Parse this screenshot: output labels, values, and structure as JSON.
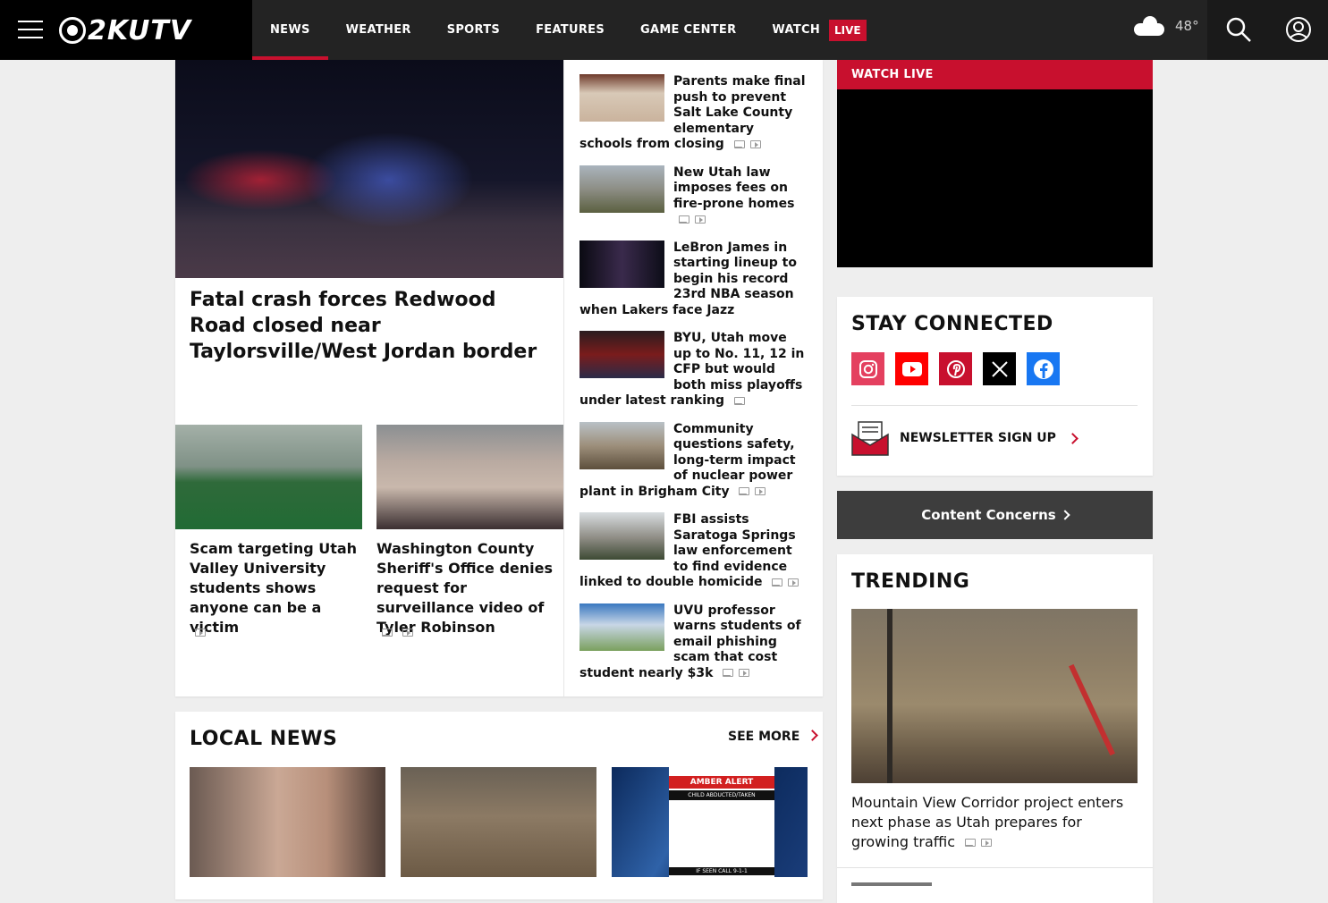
{
  "nav": {
    "logo_text": "2KUTV",
    "items": [
      "NEWS",
      "WEATHER",
      "SPORTS",
      "FEATURES",
      "GAME CENTER",
      "WATCH"
    ],
    "live_badge": "LIVE",
    "temperature": "48°",
    "colors": {
      "accent": "#c8102e",
      "bar": "#232323"
    }
  },
  "hero": {
    "title": "Fatal crash forces Redwood Road closed near Taylorsville/West Jordan border"
  },
  "secondary": [
    {
      "title": "Scam targeting Utah Valley University students shows anyone can be a victim",
      "icons": [
        "video-icon"
      ]
    },
    {
      "title": "Washington County Sheriff's Office denies request for surveillance video of Tyler Robinson",
      "icons": [
        "photo-icon",
        "video-icon"
      ]
    }
  ],
  "stories": [
    {
      "title": "Parents make final push to prevent Salt Lake County elementary schools from closing",
      "photo": true,
      "video": true
    },
    {
      "title": "New Utah law imposes fees on fire-prone homes",
      "photo": true,
      "video": true
    },
    {
      "title": "LeBron James in starting lineup to begin his record 23rd NBA season when Lakers face Jazz",
      "photo": false,
      "video": false
    },
    {
      "title": "BYU, Utah move up to No. 11, 12 in CFP but would both miss playoffs under latest ranking",
      "photo": true,
      "video": false
    },
    {
      "title": "Community questions safety, long-term impact of nuclear power plant in Brigham City",
      "photo": true,
      "video": true
    },
    {
      "title": "FBI assists Saratoga Springs law enforcement to find evidence linked to double homicide",
      "photo": true,
      "video": true
    },
    {
      "title": "UVU professor warns students of email phishing scam that cost student nearly $3k",
      "photo": true,
      "video": true
    }
  ],
  "local_news": {
    "title": "LOCAL NEWS",
    "see_more": "SEE MORE",
    "amber": {
      "header": "AMBER ALERT",
      "sub": "CHILD ABDUCTED/TAKEN",
      "footer": "IF SEEN CALL 9-1-1"
    }
  },
  "rail": {
    "watch_live": "WATCH LIVE",
    "stay_connected": "STAY CONNECTED",
    "socials": [
      "instagram-icon",
      "youtube-icon",
      "pinterest-icon",
      "x-icon",
      "facebook-icon"
    ],
    "newsletter": "NEWSLETTER SIGN UP",
    "content_concerns": "Content Concerns",
    "trending_title": "TRENDING",
    "trending_story": "Mountain View Corridor project enters next phase as Utah prepares for growing traffic"
  }
}
